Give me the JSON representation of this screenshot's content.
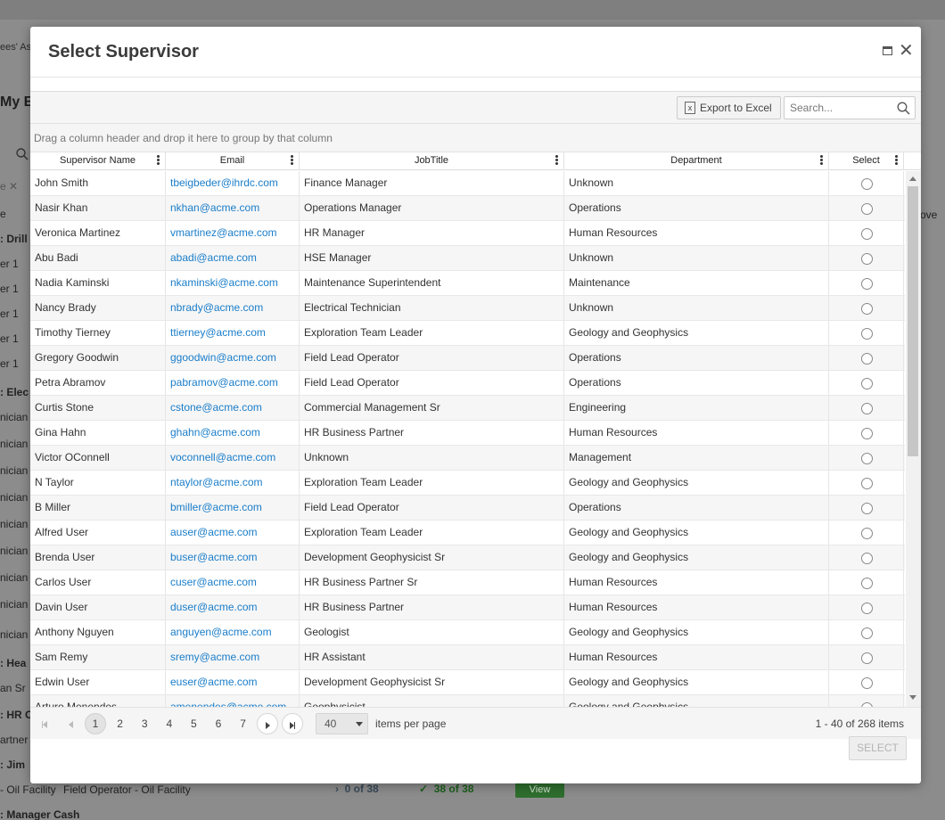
{
  "background": {
    "crumb": "ees' As",
    "title": "My E",
    "chip": "e  ✕",
    "left_labels": [
      {
        "text": "e",
        "bold": false
      },
      {
        "text": ": Drill",
        "bold": true
      },
      {
        "text": "er 1",
        "bold": false
      },
      {
        "text": "er 1",
        "bold": false
      },
      {
        "text": "er 1",
        "bold": false
      },
      {
        "text": "er 1",
        "bold": false
      },
      {
        "text": "er 1",
        "bold": false
      },
      {
        "text": ": Elec",
        "bold": true
      },
      {
        "text": "nician",
        "bold": false
      },
      {
        "text": "nician",
        "bold": false
      },
      {
        "text": "nician",
        "bold": false
      },
      {
        "text": "nician",
        "bold": false
      },
      {
        "text": "nician",
        "bold": false
      },
      {
        "text": "nician",
        "bold": false
      },
      {
        "text": "nician",
        "bold": false
      },
      {
        "text": "nician",
        "bold": false
      },
      {
        "text": "nician",
        "bold": false
      },
      {
        "text": ": Hea",
        "bold": true
      },
      {
        "text": "an Sr",
        "bold": false
      },
      {
        "text": ": HR C",
        "bold": true
      },
      {
        "text": "artner",
        "bold": false
      },
      {
        "text": ": Jim",
        "bold": true
      }
    ],
    "right_label": "ove",
    "bottom_row": {
      "col1": "- Oil Facility",
      "col2": "Field Operator - Oil Facility",
      "progress1": "0 of 38",
      "progress2": "38 of 38",
      "view_label": "View"
    },
    "last_label": ": Manager Cash"
  },
  "modal": {
    "title": "Select Supervisor",
    "toolbar": {
      "export_label": "Export to Excel",
      "search_placeholder": "Search..."
    },
    "group_hint": "Drag a column header and drop it here to group by that column",
    "columns": [
      "Supervisor Name",
      "Email",
      "JobTitle",
      "Department",
      "Select"
    ],
    "rows": [
      {
        "name": "John Smith",
        "email": "tbeigbeder@ihrdc.com",
        "job": "Finance Manager",
        "dept": "Unknown"
      },
      {
        "name": "Nasir Khan",
        "email": "nkhan@acme.com",
        "job": "Operations Manager",
        "dept": "Operations"
      },
      {
        "name": "Veronica Martinez",
        "email": "vmartinez@acme.com",
        "job": "HR Manager",
        "dept": "Human Resources"
      },
      {
        "name": "Abu Badi",
        "email": "abadi@acme.com",
        "job": "HSE Manager",
        "dept": "Unknown"
      },
      {
        "name": "Nadia Kaminski",
        "email": "nkaminski@acme.com",
        "job": "Maintenance Superintendent",
        "dept": "Maintenance"
      },
      {
        "name": "Nancy Brady",
        "email": "nbrady@acme.com",
        "job": "Electrical Technician",
        "dept": "Unknown"
      },
      {
        "name": "Timothy Tierney",
        "email": "ttierney@acme.com",
        "job": "Exploration Team Leader",
        "dept": "Geology and Geophysics"
      },
      {
        "name": "Gregory Goodwin",
        "email": "ggoodwin@acme.com",
        "job": "Field Lead Operator",
        "dept": "Operations"
      },
      {
        "name": "Petra Abramov",
        "email": "pabramov@acme.com",
        "job": "Field Lead Operator",
        "dept": "Operations"
      },
      {
        "name": "Curtis Stone",
        "email": "cstone@acme.com",
        "job": "Commercial Management Sr",
        "dept": "Engineering"
      },
      {
        "name": "Gina Hahn",
        "email": "ghahn@acme.com",
        "job": "HR Business Partner",
        "dept": "Human Resources"
      },
      {
        "name": "Victor OConnell",
        "email": "voconnell@acme.com",
        "job": "Unknown",
        "dept": "Management"
      },
      {
        "name": "N Taylor",
        "email": "ntaylor@acme.com",
        "job": "Exploration Team Leader",
        "dept": "Geology and Geophysics"
      },
      {
        "name": "B Miller",
        "email": "bmiller@acme.com",
        "job": "Field Lead Operator",
        "dept": "Operations"
      },
      {
        "name": "Alfred User",
        "email": "auser@acme.com",
        "job": "Exploration Team Leader",
        "dept": "Geology and Geophysics"
      },
      {
        "name": "Brenda User",
        "email": "buser@acme.com",
        "job": "Development Geophysicist Sr",
        "dept": "Geology and Geophysics"
      },
      {
        "name": "Carlos User",
        "email": "cuser@acme.com",
        "job": "HR Business Partner Sr",
        "dept": "Human Resources"
      },
      {
        "name": "Davin User",
        "email": "duser@acme.com",
        "job": "HR Business Partner",
        "dept": "Human Resources"
      },
      {
        "name": "Anthony Nguyen",
        "email": "anguyen@acme.com",
        "job": "Geologist",
        "dept": "Geology and Geophysics"
      },
      {
        "name": "Sam Remy",
        "email": "sremy@acme.com",
        "job": "HR Assistant",
        "dept": "Human Resources"
      },
      {
        "name": "Edwin User",
        "email": "euser@acme.com",
        "job": "Development Geophysicist Sr",
        "dept": "Geology and Geophysics"
      },
      {
        "name": "Arturo Menendes",
        "email": "amenendes@acme.com",
        "job": "Geophysicist",
        "dept": "Geology and Geophysics"
      }
    ],
    "pager": {
      "pages": [
        "1",
        "2",
        "3",
        "4",
        "5",
        "6",
        "7"
      ],
      "current_page": "1",
      "page_size": "40",
      "items_per_page_label": "items per page",
      "info": "1 - 40 of 268 items"
    },
    "select_label": "SELECT"
  },
  "icons": {
    "maximize": "window-maximize-icon",
    "close": "close-icon",
    "excel": "excel-file-icon",
    "search": "search-icon",
    "column_menu": "vertical-dots-icon"
  },
  "colors": {
    "link": "#1a7dc9",
    "overlay": "#8c8c8c"
  }
}
